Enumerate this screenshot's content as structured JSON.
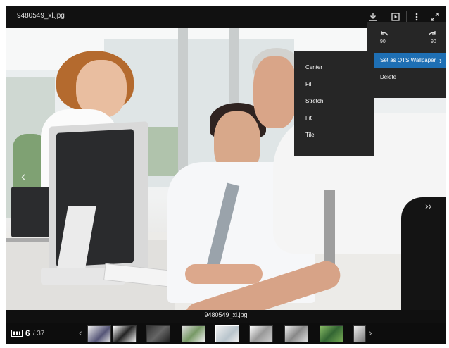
{
  "header": {
    "filename": "9480549_xl.jpg",
    "icons": [
      "download-icon",
      "slideshow-icon",
      "more-vert-icon",
      "fullscreen-icon"
    ]
  },
  "dropdown": {
    "rotate_left_label": "90",
    "rotate_right_label": "90",
    "items": [
      {
        "label": "Set as QTS Wallpaper",
        "active": true
      },
      {
        "label": "Delete",
        "active": false
      }
    ]
  },
  "submenu": {
    "items": [
      "Center",
      "Fill",
      "Stretch",
      "Fit",
      "Tile"
    ]
  },
  "viewer": {
    "caption": "9480549_xl.jpg"
  },
  "footer": {
    "current": "6",
    "total": "/ 37"
  },
  "colors": {
    "menu_highlight": "#1e6fb4",
    "menu_bg": "#262626",
    "bar_bg": "#111111"
  }
}
